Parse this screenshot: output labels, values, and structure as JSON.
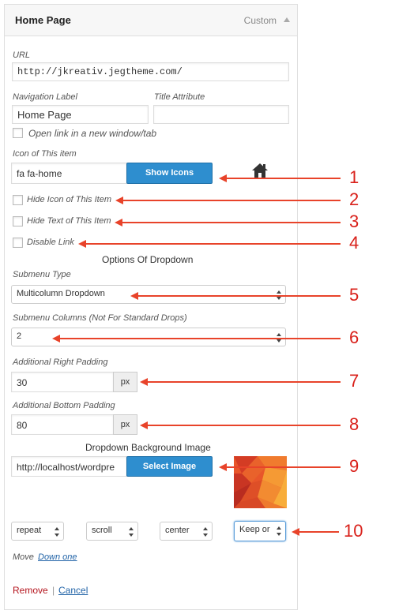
{
  "panel": {
    "title": "Home Page",
    "type": "Custom"
  },
  "url": {
    "label": "URL",
    "value": "http://jkreativ.jegtheme.com/"
  },
  "nav_label": {
    "label": "Navigation Label",
    "value": "Home Page"
  },
  "title_attr": {
    "label": "Title Attribute",
    "value": ""
  },
  "open_new": {
    "label": "Open link in a new window/tab"
  },
  "icon": {
    "label": "Icon of This item",
    "value": "fa fa-home",
    "button": "Show Icons",
    "preview_icon": "home-icon"
  },
  "hide_icon": {
    "label": "Hide Icon of This Item"
  },
  "hide_text": {
    "label": "Hide Text of This Item"
  },
  "disable_link": {
    "label": "Disable Link"
  },
  "dropdown_options": {
    "title": "Options Of Dropdown"
  },
  "submenu_type": {
    "label": "Submenu Type",
    "value": "Multicolumn Dropdown"
  },
  "submenu_columns": {
    "label": "Submenu Columns (Not For Standard Drops)",
    "value": "2"
  },
  "right_padding": {
    "label": "Additional Right Padding",
    "value": "30",
    "unit": "px"
  },
  "bottom_padding": {
    "label": "Additional Bottom Padding",
    "value": "80",
    "unit": "px"
  },
  "bg_image": {
    "title": "Dropdown Background Image",
    "value": "http://localhost/wordpre",
    "button": "Select Image"
  },
  "bg_selects": {
    "repeat": "repeat",
    "attachment": "scroll",
    "position": "center",
    "size": "Keep or"
  },
  "move": {
    "label": "Move",
    "link": "Down one"
  },
  "actions": {
    "remove": "Remove",
    "separator": "|",
    "cancel": "Cancel"
  },
  "annotations": [
    "1",
    "2",
    "3",
    "4",
    "5",
    "6",
    "7",
    "8",
    "9",
    "10"
  ],
  "colors": {
    "annotation": "#e8432a",
    "button": "#2e8ecf",
    "link": "#2163a7",
    "remove": "#b4141d"
  }
}
